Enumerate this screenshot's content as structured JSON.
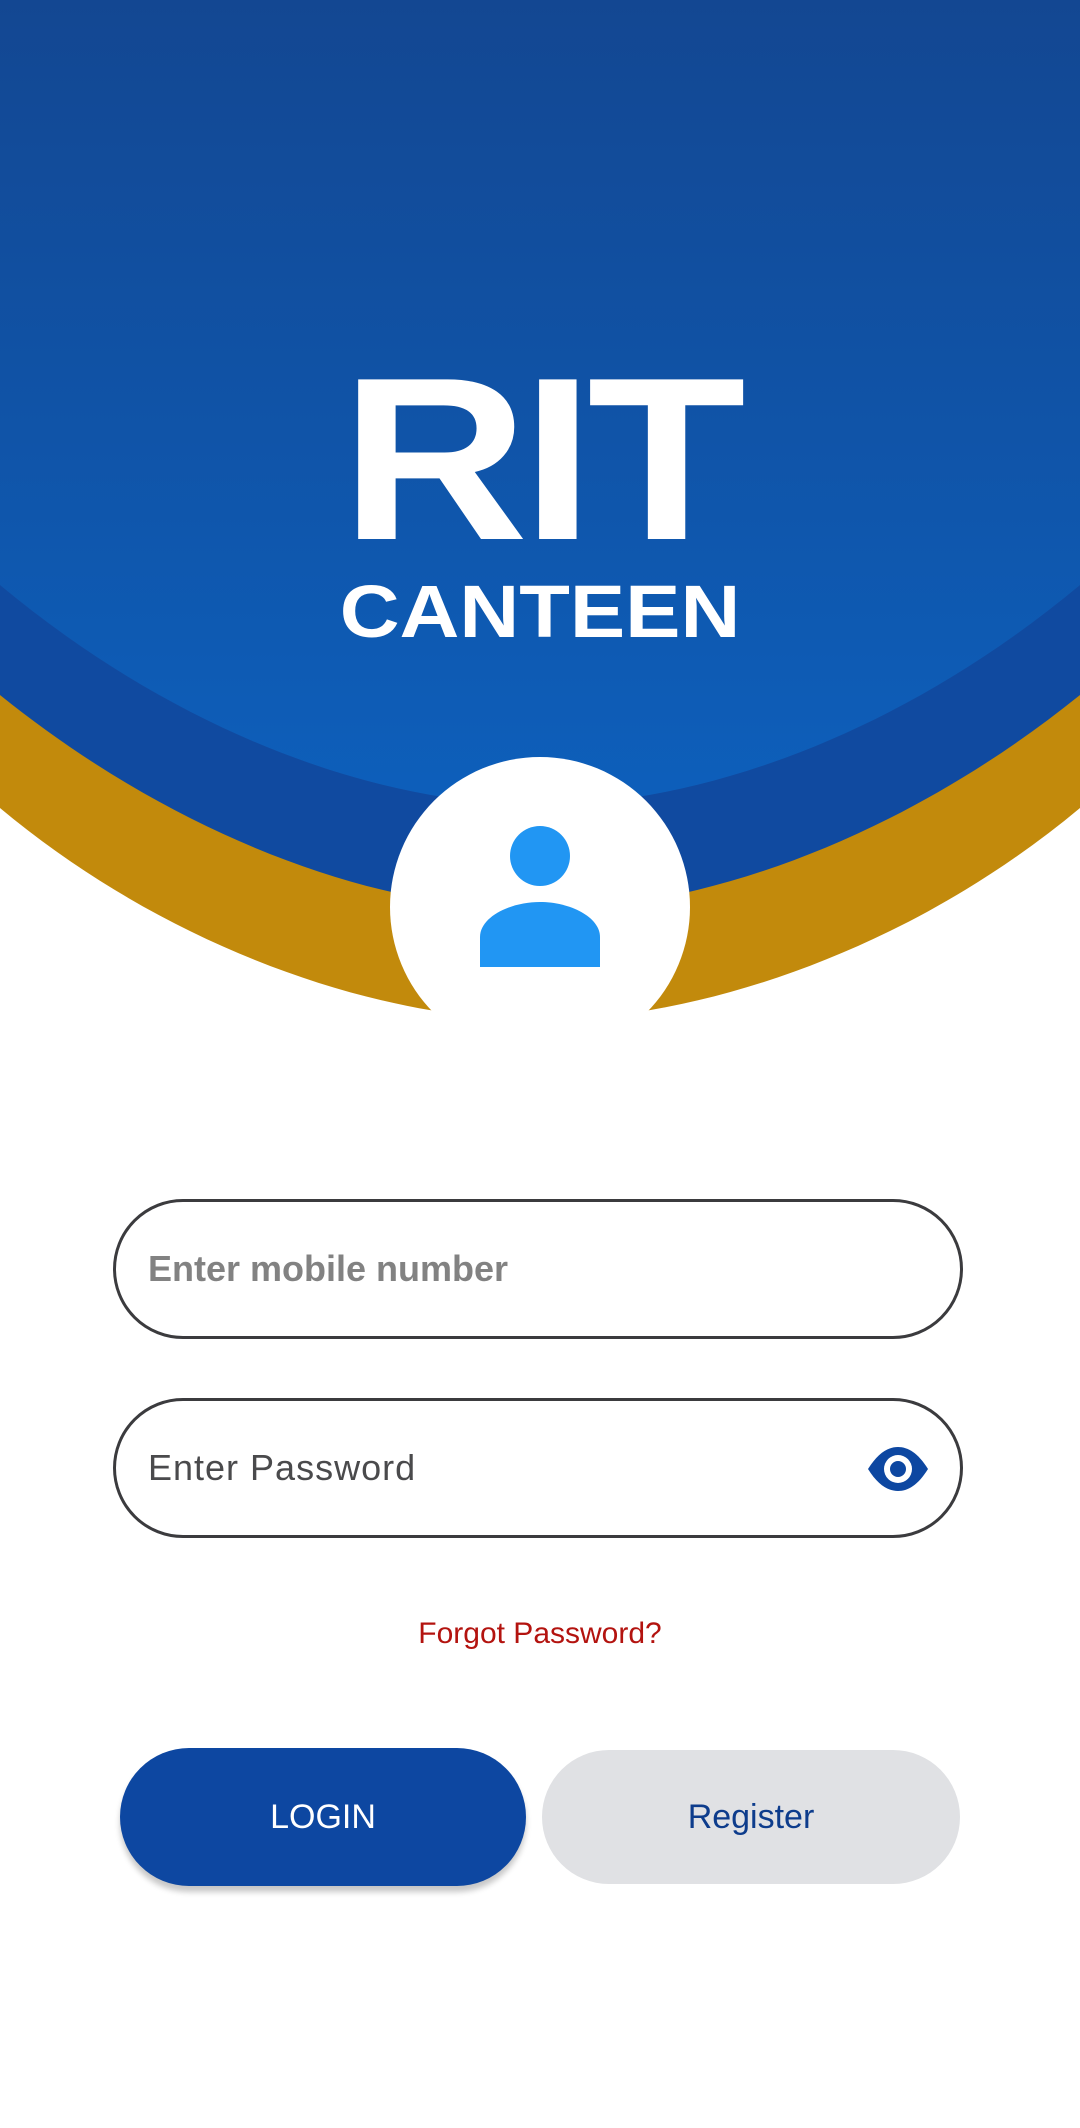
{
  "brand": {
    "title": "RIT",
    "subtitle": "CANTEEN"
  },
  "login_form": {
    "mobile_placeholder": "Enter mobile number",
    "mobile_value": "",
    "password_placeholder": "Enter Password",
    "password_value": "",
    "password_toggle_icon": "eye-icon",
    "forgot_password_label": "Forgot Password?",
    "login_label": "LOGIN",
    "register_label": "Register"
  },
  "icons": {
    "avatar": "person-icon",
    "password_toggle": "eye-icon"
  },
  "colors": {
    "primary_blue": "#0d47a1",
    "header_blue": "#0d5cb4",
    "band_blue": "#104aa0",
    "gold": "#c28a0c",
    "avatar_icon_blue": "#2196f3",
    "forgot_red": "#b3130f",
    "register_bg": "#e0e1e4"
  }
}
